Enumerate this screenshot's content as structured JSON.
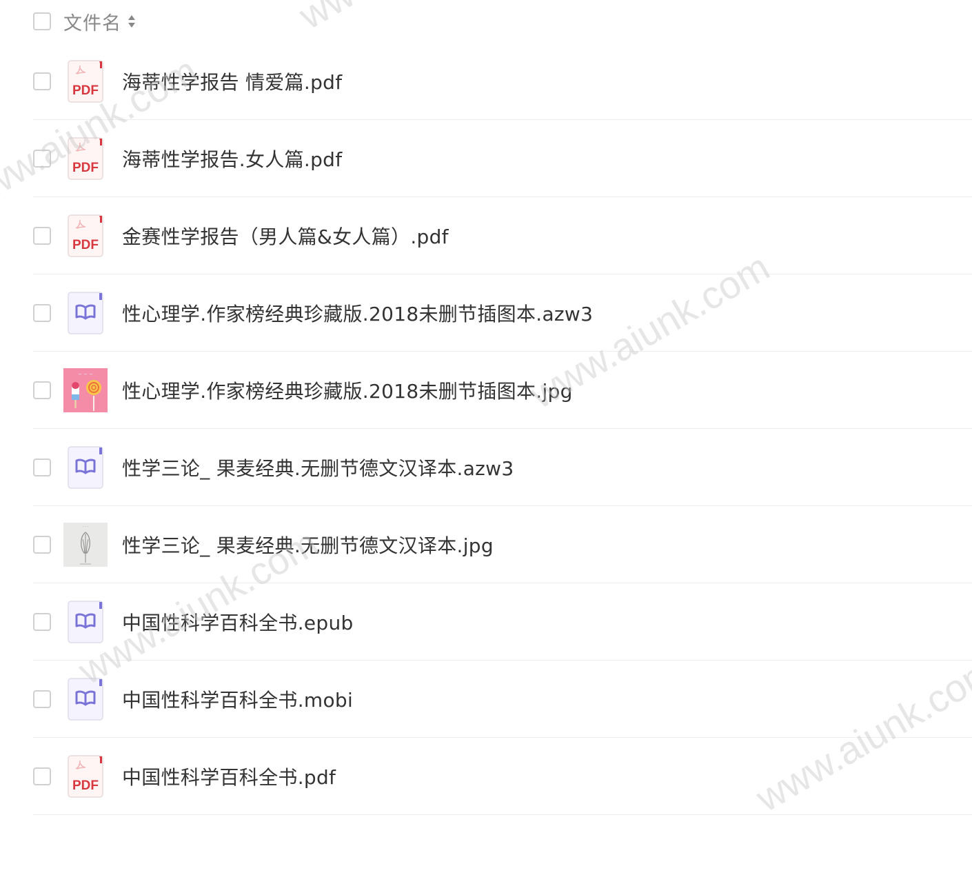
{
  "header": {
    "column_label": "文件名",
    "sort_icon": "sort-icon"
  },
  "files": [
    {
      "name": "海蒂性学报告 情爱篇.pdf",
      "type": "pdf",
      "icon": "pdf-file-icon",
      "badge": "PDF"
    },
    {
      "name": "海蒂性学报告.女人篇.pdf",
      "type": "pdf",
      "icon": "pdf-file-icon",
      "badge": "PDF"
    },
    {
      "name": "金赛性学报告（男人篇&女人篇）.pdf",
      "type": "pdf",
      "icon": "pdf-file-icon",
      "badge": "PDF"
    },
    {
      "name": "性心理学.作家榜经典珍藏版.2018未删节插图本.azw3",
      "type": "ebook",
      "icon": "ebook-file-icon"
    },
    {
      "name": "性心理学.作家榜经典珍藏版.2018未删节插图本.jpg",
      "type": "image-pink",
      "icon": "image-thumbnail"
    },
    {
      "name": "性学三论_ 果麦经典.无删节德文汉译本.azw3",
      "type": "ebook",
      "icon": "ebook-file-icon"
    },
    {
      "name": "性学三论_ 果麦经典.无删节德文汉译本.jpg",
      "type": "image-gray",
      "icon": "image-thumbnail"
    },
    {
      "name": "中国性科学百科全书.epub",
      "type": "ebook",
      "icon": "ebook-file-icon"
    },
    {
      "name": "中国性科学百科全书.mobi",
      "type": "ebook",
      "icon": "ebook-file-icon"
    },
    {
      "name": "中国性科学百科全书.pdf",
      "type": "pdf",
      "icon": "pdf-file-icon",
      "badge": "PDF"
    }
  ],
  "watermarks": [
    "www.aiunk.com",
    "www.aiunk.com",
    "www.aiunk.com",
    "www.aiunk.com"
  ],
  "colors": {
    "pdf_red": "#d9373f",
    "ebook_purple": "#7b74d8",
    "pink_bg": "#f48ca8"
  }
}
